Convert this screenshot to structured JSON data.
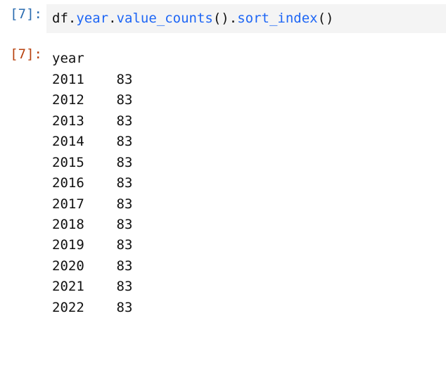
{
  "input_cell": {
    "exec_count": 7,
    "tokens": [
      {
        "text": "df",
        "cls": "tok-plain"
      },
      {
        "text": ".",
        "cls": "tok-plain"
      },
      {
        "text": "year",
        "cls": "tok-attr"
      },
      {
        "text": ".",
        "cls": "tok-plain"
      },
      {
        "text": "value_counts",
        "cls": "tok-func"
      },
      {
        "text": "()",
        "cls": "tok-plain"
      },
      {
        "text": ".",
        "cls": "tok-plain"
      },
      {
        "text": "sort_index",
        "cls": "tok-func"
      },
      {
        "text": "()",
        "cls": "tok-plain"
      }
    ]
  },
  "output_cell": {
    "exec_count": 7,
    "title": "year",
    "rows": [
      {
        "key": "2011",
        "value": "83"
      },
      {
        "key": "2012",
        "value": "83"
      },
      {
        "key": "2013",
        "value": "83"
      },
      {
        "key": "2014",
        "value": "83"
      },
      {
        "key": "2015",
        "value": "83"
      },
      {
        "key": "2016",
        "value": "83"
      },
      {
        "key": "2017",
        "value": "83"
      },
      {
        "key": "2018",
        "value": "83"
      },
      {
        "key": "2019",
        "value": "83"
      },
      {
        "key": "2020",
        "value": "83"
      },
      {
        "key": "2021",
        "value": "83"
      },
      {
        "key": "2022",
        "value": "83"
      }
    ],
    "key_width": 8,
    "value_width": 2
  },
  "chart_data": {
    "type": "table",
    "title": "year",
    "categories": [
      "2011",
      "2012",
      "2013",
      "2014",
      "2015",
      "2016",
      "2017",
      "2018",
      "2019",
      "2020",
      "2021",
      "2022"
    ],
    "values": [
      83,
      83,
      83,
      83,
      83,
      83,
      83,
      83,
      83,
      83,
      83,
      83
    ]
  }
}
